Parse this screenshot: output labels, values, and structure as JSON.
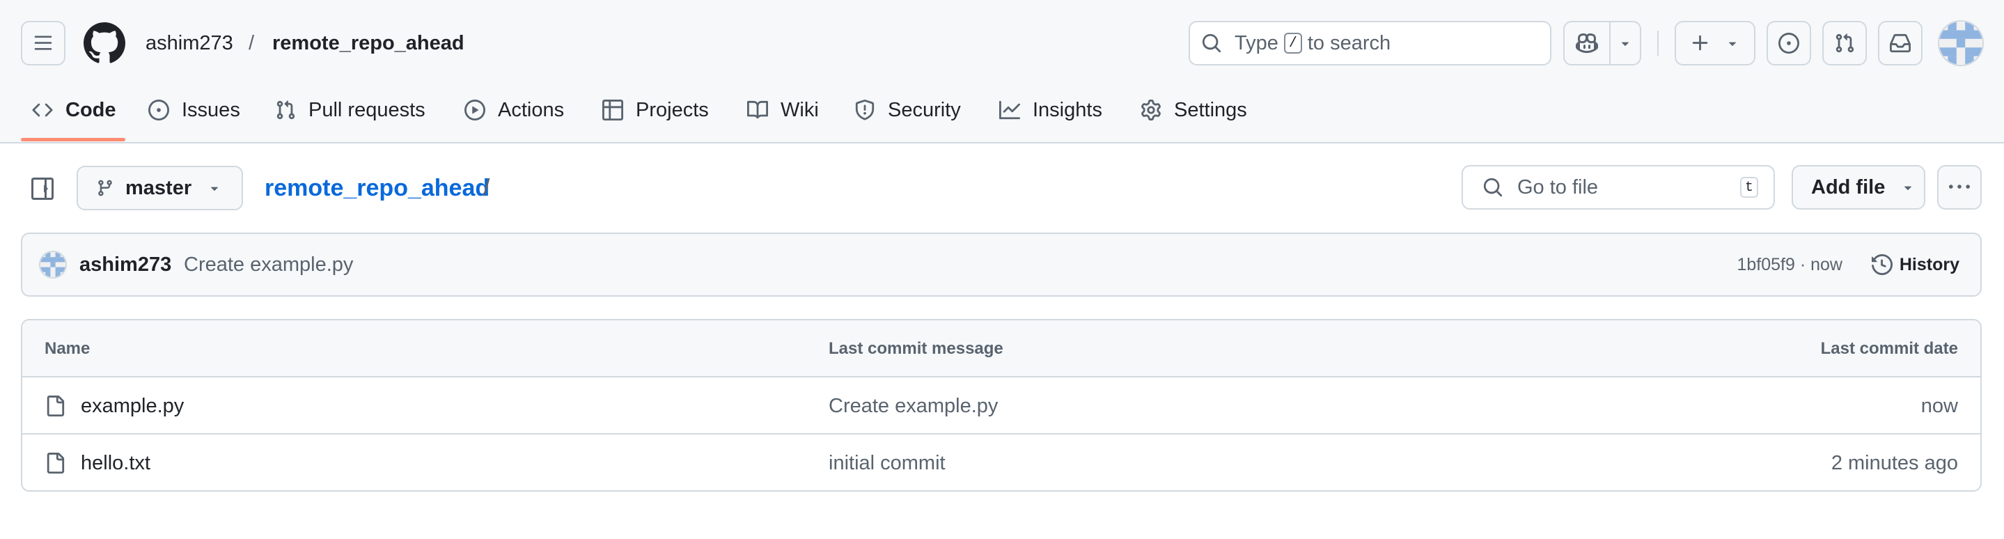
{
  "header": {
    "owner": "ashim273",
    "separator": "/",
    "repo": "remote_repo_ahead",
    "search": {
      "prefix": "Type",
      "key": "/",
      "suffix": "to search"
    }
  },
  "tabs": [
    {
      "label": "Code",
      "icon": "code-icon",
      "selected": true
    },
    {
      "label": "Issues",
      "icon": "issue-opened-icon"
    },
    {
      "label": "Pull requests",
      "icon": "git-pull-request-icon"
    },
    {
      "label": "Actions",
      "icon": "play-icon"
    },
    {
      "label": "Projects",
      "icon": "table-icon"
    },
    {
      "label": "Wiki",
      "icon": "book-icon"
    },
    {
      "label": "Security",
      "icon": "shield-icon"
    },
    {
      "label": "Insights",
      "icon": "graph-icon"
    },
    {
      "label": "Settings",
      "icon": "gear-icon"
    }
  ],
  "repo_bar": {
    "branch": "master",
    "repo_link": "remote_repo_ahead",
    "path_separator": "/",
    "goto_placeholder": "Go to file",
    "goto_key": "t",
    "add_file": "Add file"
  },
  "latest_commit": {
    "author": "ashim273",
    "message": "Create example.py",
    "sha": "1bf05f9",
    "dot": "·",
    "time": "now",
    "history": "History"
  },
  "file_table": {
    "columns": [
      "Name",
      "Last commit message",
      "Last commit date"
    ],
    "rows": [
      {
        "name": "example.py",
        "message": "Create example.py",
        "date": "now"
      },
      {
        "name": "hello.txt",
        "message": "initial commit",
        "date": "2 minutes ago"
      }
    ]
  },
  "colors": {
    "accent_link": "#0969da",
    "tab_underline": "#fd8c73",
    "border": "#d1d9e0",
    "header_bg": "#f6f8fa"
  }
}
